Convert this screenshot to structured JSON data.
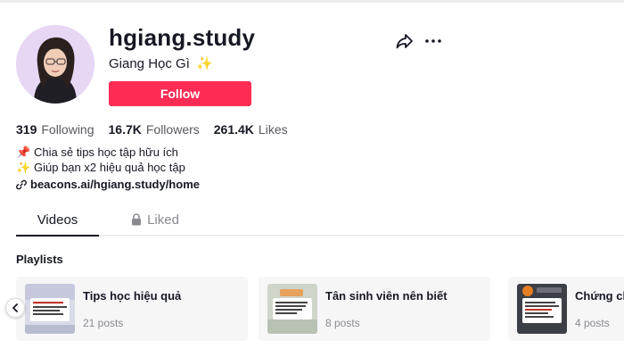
{
  "profile": {
    "username": "hgiang.study",
    "nickname": "Giang Học Gì",
    "nickname_emoji": "✨",
    "follow_label": "Follow",
    "avatar_icon": "profile-photo"
  },
  "stats": [
    {
      "value": "319",
      "label": "Following"
    },
    {
      "value": "16.7K",
      "label": "Followers"
    },
    {
      "value": "261.4K",
      "label": "Likes"
    }
  ],
  "bio": {
    "lines": [
      {
        "emoji": "📌",
        "text": "Chia sẻ tips học tập hữu ích"
      },
      {
        "emoji": "✨",
        "text": "Giúp bạn x2 hiệu quả học tập"
      }
    ],
    "link": "beacons.ai/hgiang.study/home"
  },
  "tabs": [
    {
      "label": "Videos",
      "active": true
    },
    {
      "label": "Liked",
      "active": false,
      "icon": "lock-icon"
    }
  ],
  "playlists": {
    "title": "Playlists",
    "items": [
      {
        "name": "Tips học hiệu quả",
        "posts": "21 posts"
      },
      {
        "name": "Tân sinh viên nên biết",
        "posts": "8 posts"
      },
      {
        "name": "Chứng ch",
        "posts": "4 posts"
      }
    ]
  },
  "colors": {
    "accent": "#fe2c55",
    "text_primary": "#161823",
    "text_secondary": "#8a8b91",
    "card_bg": "#f6f6f7"
  }
}
